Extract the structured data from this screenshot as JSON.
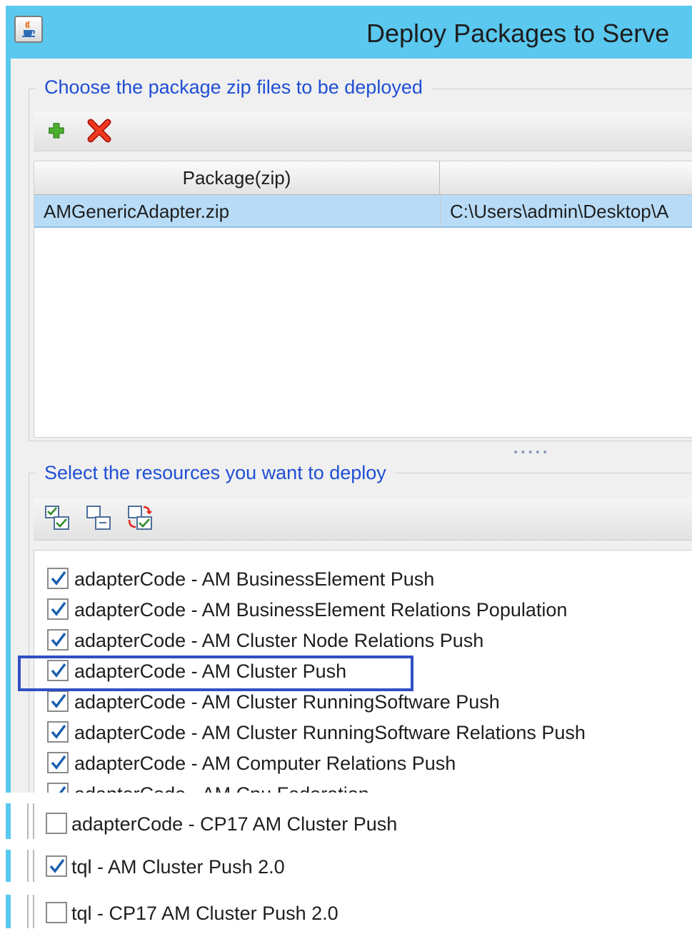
{
  "window": {
    "title": "Deploy Packages to Serve",
    "icon": "java-cup-icon"
  },
  "packages_section": {
    "title": "Choose the package zip files to be deployed",
    "toolbar": [
      {
        "icon": "add-icon",
        "color": "#4caf2e"
      },
      {
        "icon": "delete-icon",
        "color": "#e0261b"
      }
    ],
    "table": {
      "columns": [
        "Package(zip)",
        ""
      ],
      "rows": [
        {
          "package": "AMGenericAdapter.zip",
          "path": "C:\\Users\\admin\\Desktop\\A",
          "selected": true
        }
      ]
    }
  },
  "splitter": {
    "grip": "•••••"
  },
  "resources_section": {
    "title": "Select the resources you want to deploy",
    "toolbar": [
      {
        "icon": "select-all-icon"
      },
      {
        "icon": "deselect-all-icon"
      },
      {
        "icon": "invert-selection-icon"
      }
    ],
    "items": [
      {
        "label": "adapterCode - AM BusinessElement Push",
        "checked": true
      },
      {
        "label": "adapterCode - AM BusinessElement Relations Population",
        "checked": true
      },
      {
        "label": "adapterCode - AM Cluster Node Relations Push",
        "checked": true
      },
      {
        "label": "adapterCode - AM Cluster Push",
        "checked": true,
        "highlighted": true
      },
      {
        "label": "adapterCode - AM Cluster RunningSoftware Push",
        "checked": true
      },
      {
        "label": "adapterCode - AM Cluster RunningSoftware Relations Push",
        "checked": true
      },
      {
        "label": "adapterCode - AM Computer Relations Push",
        "checked": true
      },
      {
        "label": "adapterCode - AM Cpu Federation",
        "checked": true,
        "partially_visible": true
      }
    ],
    "cropped_items": [
      {
        "label": "adapterCode - CP17 AM Cluster Push",
        "checked": false
      },
      {
        "label": "tql - AM Cluster Push 2.0",
        "checked": true
      },
      {
        "label": "tql - CP17 AM Cluster Push 2.0",
        "checked": false
      }
    ]
  },
  "colors": {
    "title_bar": "#5ac8ef",
    "group_title": "#1f4fd4",
    "selected_row": "#b8dcf7",
    "highlight_box": "#2f4fc4",
    "checkmark": "#1b5fb0"
  }
}
